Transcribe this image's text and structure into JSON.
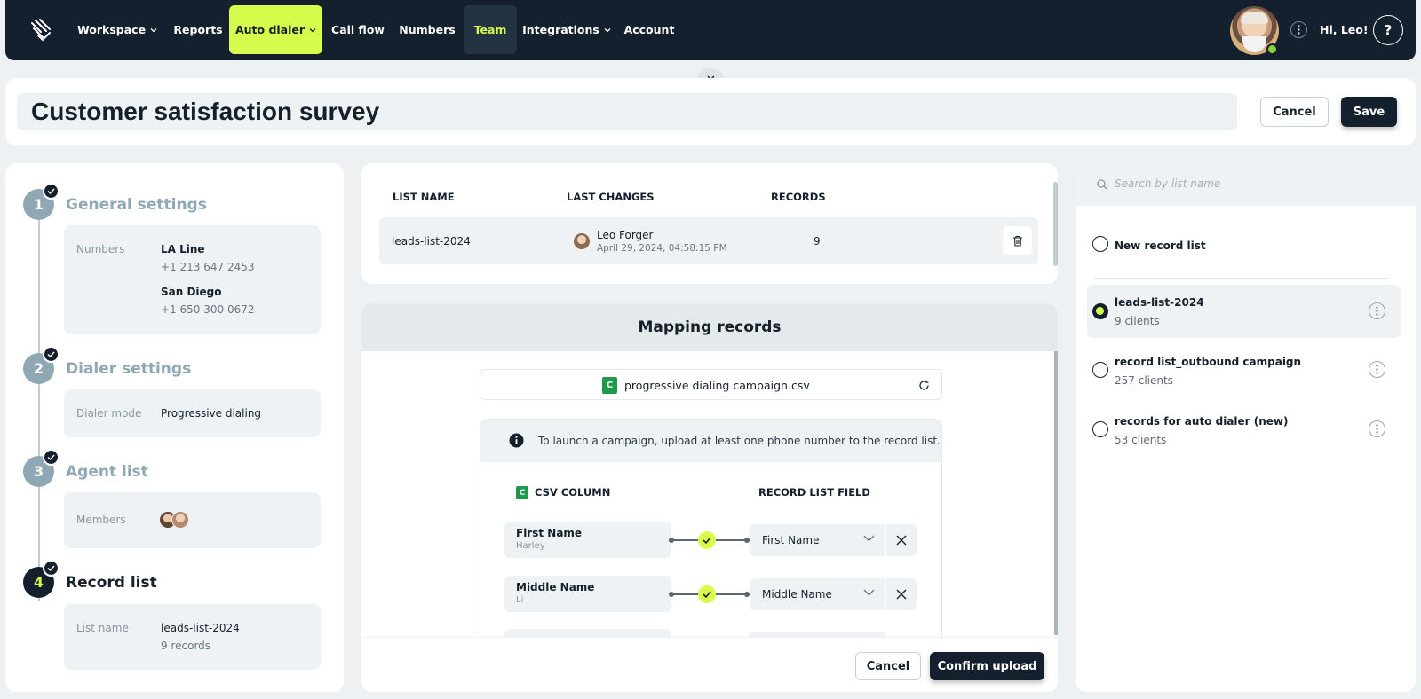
{
  "nav": {
    "items": [
      {
        "label": "Workspace",
        "dropdown": true
      },
      {
        "label": "Reports"
      },
      {
        "label": "Auto dialer",
        "dropdown": true,
        "active": true
      },
      {
        "label": "Call flow"
      },
      {
        "label": "Numbers"
      },
      {
        "label": "Team"
      },
      {
        "label": "Integrations",
        "dropdown": true
      },
      {
        "label": "Account"
      }
    ],
    "greeting": "Hi, Leo!",
    "help_glyph": "?",
    "accent": "#d8fc4b",
    "bg": "#15202e"
  },
  "page": {
    "title": "Customer satisfaction survey",
    "cancel_label": "Cancel",
    "save_label": "Save"
  },
  "steps": [
    {
      "num": "1",
      "title": "General settings",
      "numbers_label": "Numbers",
      "lines": [
        {
          "name": "LA Line",
          "phone": "+1 213 647 2453"
        },
        {
          "name": "San Diego",
          "phone": "+1 650 300 0672"
        }
      ]
    },
    {
      "num": "2",
      "title": "Dialer settings",
      "key": "Dialer mode",
      "value": "Progressive dialing"
    },
    {
      "num": "3",
      "title": "Agent list",
      "key": "Members"
    },
    {
      "num": "4",
      "title": "Record list",
      "key": "List name",
      "value": "leads-list-2024",
      "sub": "9 records"
    }
  ],
  "list_table": {
    "headers": [
      "LIST NAME",
      "LAST CHANGES",
      "RECORDS"
    ],
    "row": {
      "name": "leads-list-2024",
      "changed_by": "Leo Forger",
      "changed_at": "April 29, 2024, 04:58:15 PM",
      "records": "9"
    }
  },
  "mapping": {
    "title": "Mapping records",
    "file_name": "progressive dialing campaign.csv",
    "file_icon_letter": "C",
    "info_text": "To launch a campaign, upload at least one phone number to the record list.",
    "col_csv": "CSV COLUMN",
    "col_field": "RECORD LIST FIELD",
    "rows": [
      {
        "column": "First Name",
        "sample": "Harley",
        "field": "First Name"
      },
      {
        "column": "Middle Name",
        "sample": "Li",
        "field": "Middle Name"
      }
    ],
    "cancel_label": "Cancel",
    "confirm_label": "Confirm upload"
  },
  "record_lists": {
    "search_placeholder": "Search by list name",
    "new_label": "New record list",
    "items": [
      {
        "name": "leads-list-2024",
        "count": "9 clients",
        "selected": true
      },
      {
        "name": "record list_outbound campaign",
        "count": "257 clients"
      },
      {
        "name": "records for auto dialer (new)",
        "count": "53 clients"
      }
    ]
  }
}
